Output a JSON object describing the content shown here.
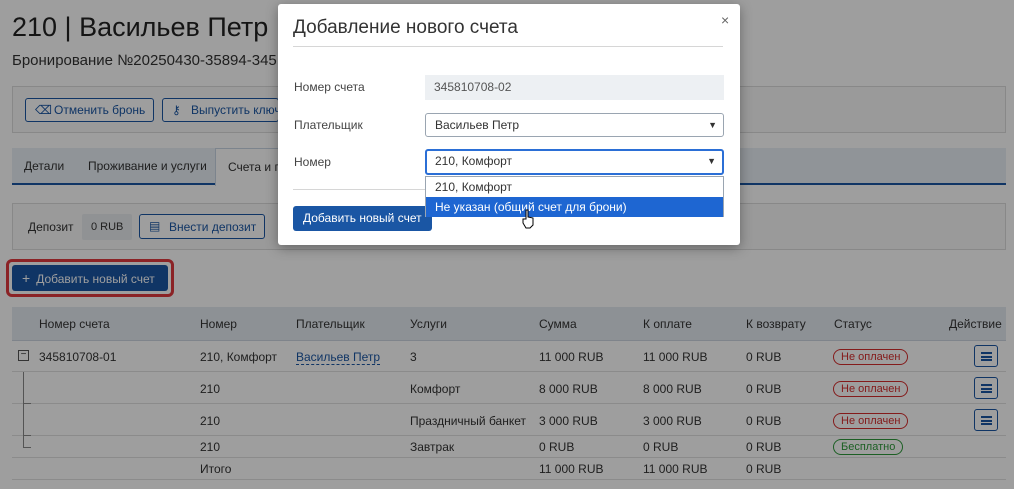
{
  "page": {
    "title": "210 | Васильев Петр |",
    "subtitle": "Бронирование №20250430-35894-345",
    "actions": {
      "cancel_booking": "Отменить бронь",
      "issue_key": "Выпустить ключ"
    },
    "tabs": [
      "Детали",
      "Проживание и услуги",
      "Счета и п"
    ],
    "deposit": {
      "label": "Депозит",
      "value": "0 RUB",
      "button": "Внести депозит"
    },
    "add_account_button": "Добавить новый счет"
  },
  "table": {
    "headers": [
      "Номер счета",
      "Номер",
      "Плательщик",
      "Услуги",
      "Сумма",
      "К оплате",
      "К возврату",
      "Статус",
      "Действие"
    ],
    "rows": [
      {
        "account": "345810708-01",
        "room": "210, Комфорт",
        "payer": "Васильев Петр",
        "services": "3",
        "sum": "11 000 RUB",
        "to_pay": "11 000 RUB",
        "refund": "0 RUB",
        "status": "Не оплачен"
      },
      {
        "account": "",
        "room": "210",
        "payer": "",
        "services": "Комфорт",
        "sum": "8 000 RUB",
        "to_pay": "8 000 RUB",
        "refund": "0 RUB",
        "status": "Не оплачен"
      },
      {
        "account": "",
        "room": "210",
        "payer": "",
        "services": "Праздничный банкет",
        "sum": "3 000 RUB",
        "to_pay": "3 000 RUB",
        "refund": "0 RUB",
        "status": "Не оплачен"
      },
      {
        "account": "",
        "room": "210",
        "payer": "",
        "services": "Завтрак",
        "sum": "0 RUB",
        "to_pay": "0 RUB",
        "refund": "0 RUB",
        "status": "Бесплатно"
      }
    ],
    "total": {
      "label": "Итого",
      "sum": "11 000 RUB",
      "to_pay": "11 000 RUB",
      "refund": "0 RUB"
    }
  },
  "modal": {
    "title": "Добавление нового счета",
    "close_glyph": "×",
    "account_label": "Номер счета",
    "account_value": "345810708-02",
    "payer_label": "Плательщик",
    "payer_value": "Васильев Петр",
    "room_label": "Номер",
    "room_value": "210, Комфорт",
    "room_options": [
      "210, Комфорт",
      "Не указан (общий счет для брони)"
    ],
    "highlighted_option": 1,
    "submit": "Добавить новый счет"
  },
  "icons": {
    "cancel_booking": "cancel-x-icon",
    "issue_key": "key-icon",
    "deposit": "wallet-icon",
    "add": "plus-icon",
    "row_menu": "hamburger-menu-icon",
    "tree": "collapse-minus-icon"
  },
  "colors": {
    "brand": "#1a56a4",
    "unpaid": "#d62d2d",
    "free": "#2e9a3a",
    "highlight_border": "#e0393e",
    "option_selected": "#1e66d2"
  }
}
